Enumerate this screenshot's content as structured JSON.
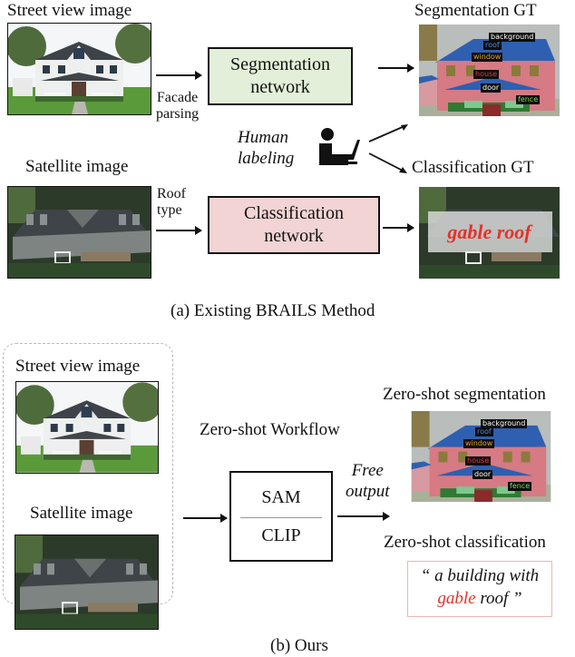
{
  "part_a": {
    "street_view_label": "Street view image",
    "satellite_label": "Satellite image",
    "facade_parsing_label": [
      "Facade",
      "parsing"
    ],
    "roof_type_label": [
      "Roof",
      "type"
    ],
    "segmentation_network": [
      "Segmentation",
      "network"
    ],
    "classification_network": [
      "Classification",
      "network"
    ],
    "human_labeling": [
      "Human",
      "labeling"
    ],
    "segmentation_gt_label": "Segmentation GT",
    "classification_gt_label": "Classification GT",
    "classification_gt_overlay": "gable roof",
    "caption": "(a) Existing BRAILS Method"
  },
  "part_b": {
    "street_view_label": "Street view image",
    "satellite_label": "Satellite image",
    "workflow_title": "Zero-shot Workflow",
    "model_top": "SAM",
    "model_bottom": "CLIP",
    "free_output": [
      "Free",
      "output"
    ],
    "zero_shot_segmentation_label": "Zero-shot segmentation",
    "zero_shot_classification_label": "Zero-shot classification",
    "classification_output": {
      "line1": "“ a building with",
      "highlight": "gable",
      "line2_rest": " roof ”"
    },
    "caption": "(b) Ours"
  },
  "segmentation_tags": [
    {
      "label": "background",
      "color": "#ffffff"
    },
    {
      "label": "roof",
      "color": "#4f86d9"
    },
    {
      "label": "window",
      "color": "#e0a030"
    },
    {
      "label": "house",
      "color": "#e03a3a"
    },
    {
      "label": "door",
      "color": "#ffffff"
    },
    {
      "label": "fence",
      "color": "#7fdc55"
    }
  ],
  "colors": {
    "segmentation_box_fill": "#e3efd9",
    "classification_box_fill": "#f1d4d3",
    "highlight_red": "#e8302a",
    "output_border": "#e8b7b4",
    "dashed_border": "#b8b8b8"
  }
}
